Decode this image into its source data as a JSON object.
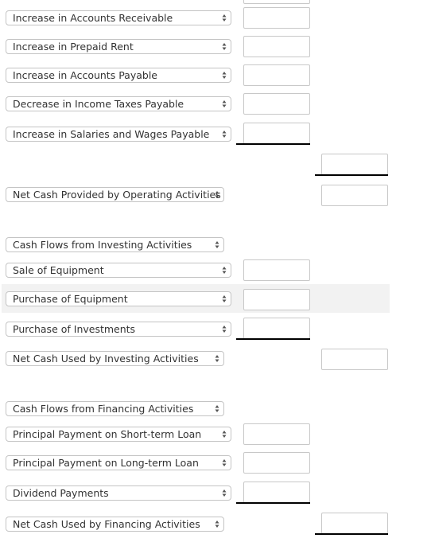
{
  "operating": {
    "items": [
      {
        "label": "Increase in Accounts Receivable",
        "amount": ""
      },
      {
        "label": "Increase in Prepaid Rent",
        "amount": ""
      },
      {
        "label": "Increase in Accounts Payable",
        "amount": ""
      },
      {
        "label": "Decrease in Income Taxes Payable",
        "amount": ""
      },
      {
        "label": "Increase in Salaries and Wages Payable",
        "amount": ""
      }
    ],
    "subtotal": "",
    "net_label": "Net Cash Provided by Operating Activities",
    "net_amount": ""
  },
  "investing": {
    "header": "Cash Flows from Investing Activities",
    "items": [
      {
        "label": "Sale of Equipment",
        "amount": ""
      },
      {
        "label": "Purchase of Equipment",
        "amount": ""
      },
      {
        "label": "Purchase of Investments",
        "amount": ""
      }
    ],
    "net_label": "Net Cash Used by Investing Activities",
    "net_amount": ""
  },
  "financing": {
    "header": "Cash Flows from Financing Activities",
    "items": [
      {
        "label": "Principal Payment on Short-term Loan",
        "amount": ""
      },
      {
        "label": "Principal Payment on Long-term Loan",
        "amount": ""
      },
      {
        "label": "Dividend Payments",
        "amount": ""
      }
    ],
    "net_label": "Net Cash Used by Financing Activities",
    "net_amount": ""
  },
  "icons": {
    "select_arrow": "up-down-chevron-icon"
  },
  "colors": {
    "highlight_row": "#f2f2f2",
    "border": "#c4c4c4",
    "underline": "#000000"
  }
}
